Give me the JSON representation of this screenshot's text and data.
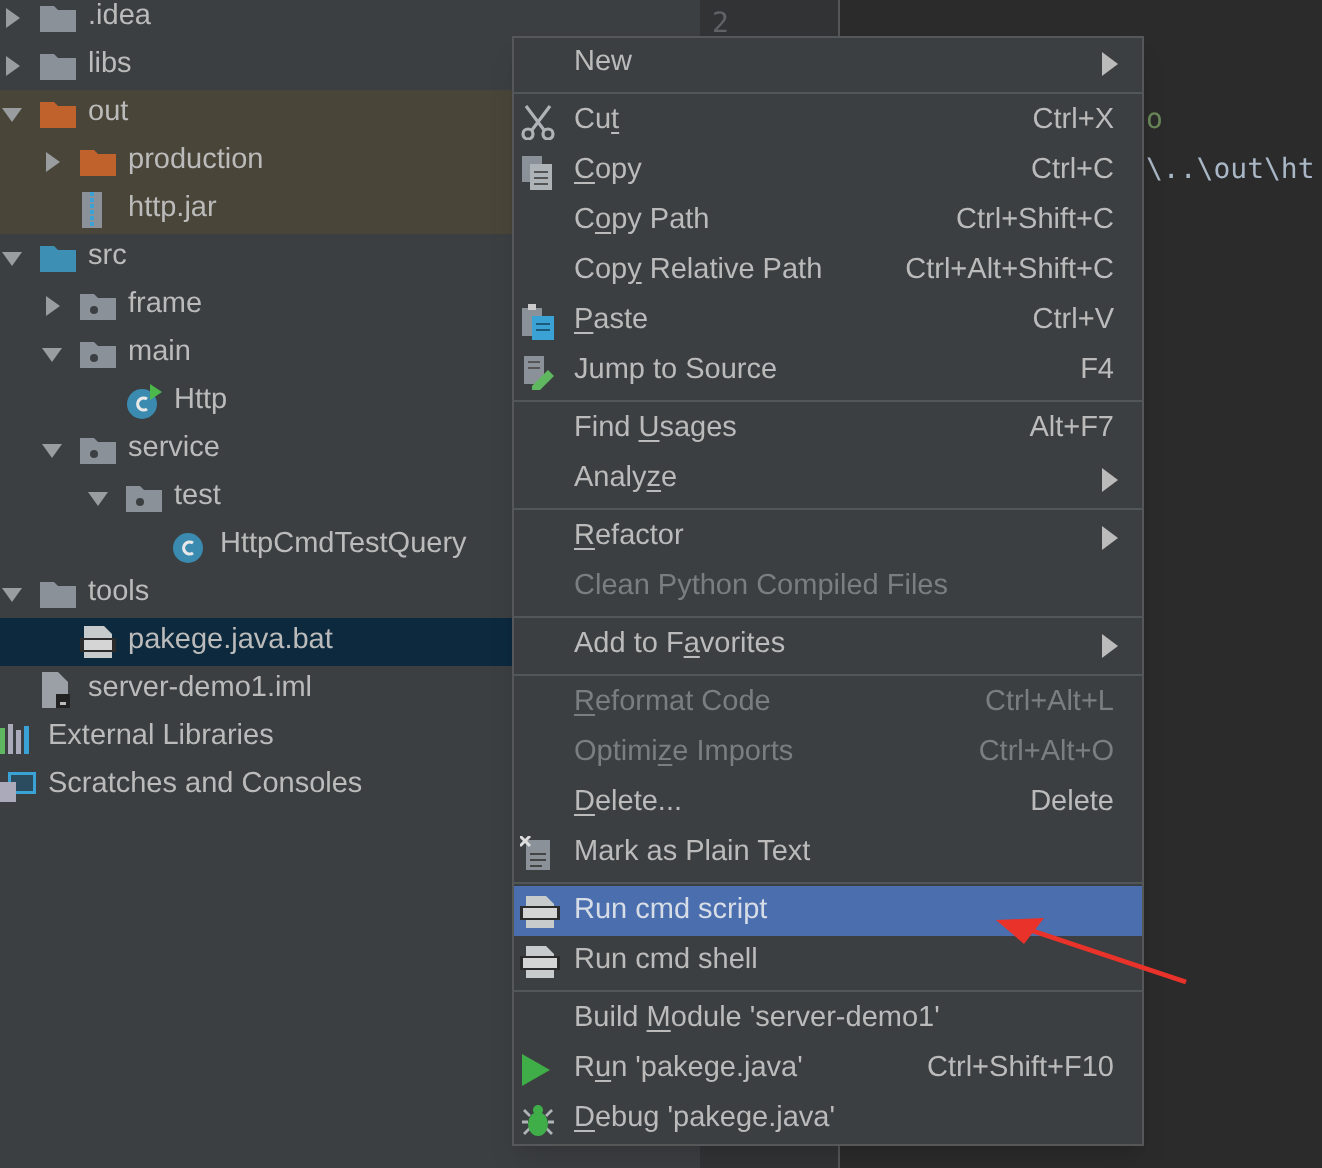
{
  "tree": [
    {
      "label": ".idea",
      "kind": "folder",
      "expanded": false,
      "excluded": false
    },
    {
      "label": "libs",
      "kind": "folder",
      "expanded": false,
      "excluded": false
    },
    {
      "label": "out",
      "kind": "folder",
      "expanded": true,
      "excluded": true,
      "children": [
        {
          "label": "production",
          "kind": "folder",
          "expanded": false,
          "excluded": true
        },
        {
          "label": "http.jar",
          "kind": "jar",
          "excluded": true
        }
      ]
    },
    {
      "label": "src",
      "kind": "source-folder",
      "expanded": true,
      "children": [
        {
          "label": "frame",
          "kind": "package",
          "expanded": false
        },
        {
          "label": "main",
          "kind": "package",
          "expanded": true,
          "children": [
            {
              "label": "Http",
              "kind": "class-runnable"
            }
          ]
        },
        {
          "label": "service",
          "kind": "package",
          "expanded": true,
          "children": [
            {
              "label": "test",
              "kind": "package",
              "expanded": true,
              "children": [
                {
                  "label": "HttpCmdTestQuery",
                  "kind": "class"
                }
              ]
            }
          ]
        }
      ]
    },
    {
      "label": "tools",
      "kind": "folder",
      "expanded": true,
      "excluded": false,
      "children": [
        {
          "label": "pakege.java.bat",
          "kind": "bat",
          "selected": true
        }
      ]
    },
    {
      "label": "server-demo1.iml",
      "kind": "iml"
    },
    {
      "label": "External Libraries",
      "kind": "libraries"
    },
    {
      "label": "Scratches and Consoles",
      "kind": "scratches"
    }
  ],
  "editor": {
    "line_number": "2",
    "code_lines": [
      {
        "text": "o",
        "kind": "string"
      },
      {
        "text": "\\..\\out\\ht",
        "kind": "plain"
      }
    ]
  },
  "context_menu": [
    {
      "kind": "item",
      "label": "New",
      "submenu": true,
      "disabled": false,
      "selected": false
    },
    {
      "kind": "separator"
    },
    {
      "kind": "item",
      "label": "Cut",
      "shortcut": "Ctrl+X",
      "disabled": false,
      "selected": false
    },
    {
      "kind": "item",
      "label": "Copy",
      "shortcut": "Ctrl+C",
      "disabled": false,
      "selected": false
    },
    {
      "kind": "item",
      "label": "Copy Path",
      "shortcut": "Ctrl+Shift+C",
      "disabled": false,
      "selected": false
    },
    {
      "kind": "item",
      "label": "Copy Relative Path",
      "shortcut": "Ctrl+Alt+Shift+C",
      "disabled": false,
      "selected": false
    },
    {
      "kind": "item",
      "label": "Paste",
      "shortcut": "Ctrl+V",
      "disabled": false,
      "selected": false
    },
    {
      "kind": "item",
      "label": "Jump to Source",
      "shortcut": "F4",
      "disabled": false,
      "selected": false
    },
    {
      "kind": "separator"
    },
    {
      "kind": "item",
      "label": "Find Usages",
      "shortcut": "Alt+F7",
      "disabled": false,
      "selected": false
    },
    {
      "kind": "item",
      "label": "Analyze",
      "submenu": true,
      "disabled": false,
      "selected": false
    },
    {
      "kind": "separator"
    },
    {
      "kind": "item",
      "label": "Refactor",
      "submenu": true,
      "disabled": false,
      "selected": false
    },
    {
      "kind": "item",
      "label": "Clean Python Compiled Files",
      "disabled": true,
      "selected": false
    },
    {
      "kind": "separator"
    },
    {
      "kind": "item",
      "label": "Add to Favorites",
      "submenu": true,
      "disabled": false,
      "selected": false
    },
    {
      "kind": "separator"
    },
    {
      "kind": "item",
      "label": "Reformat Code",
      "shortcut": "Ctrl+Alt+L",
      "disabled": true,
      "selected": false
    },
    {
      "kind": "item",
      "label": "Optimize Imports",
      "shortcut": "Ctrl+Alt+O",
      "disabled": true,
      "selected": false
    },
    {
      "kind": "item",
      "label": "Delete...",
      "shortcut": "Delete",
      "disabled": false,
      "selected": false
    },
    {
      "kind": "item",
      "label": "Mark as Plain Text",
      "disabled": false,
      "selected": false
    },
    {
      "kind": "separator"
    },
    {
      "kind": "item",
      "label": "Run cmd script",
      "disabled": false,
      "selected": true
    },
    {
      "kind": "item",
      "label": "Run cmd shell",
      "disabled": false,
      "selected": false
    },
    {
      "kind": "separator"
    },
    {
      "kind": "item",
      "label": "Build Module 'server-demo1'",
      "disabled": false,
      "selected": false
    },
    {
      "kind": "item",
      "label": "Run 'pakege.java'",
      "shortcut": "Ctrl+Shift+F10",
      "disabled": false,
      "selected": false
    },
    {
      "kind": "item",
      "label": "Debug 'pakege.java'",
      "disabled": false,
      "selected": false
    }
  ],
  "annotation": {
    "kind": "arrow",
    "color": "#e8322a"
  }
}
